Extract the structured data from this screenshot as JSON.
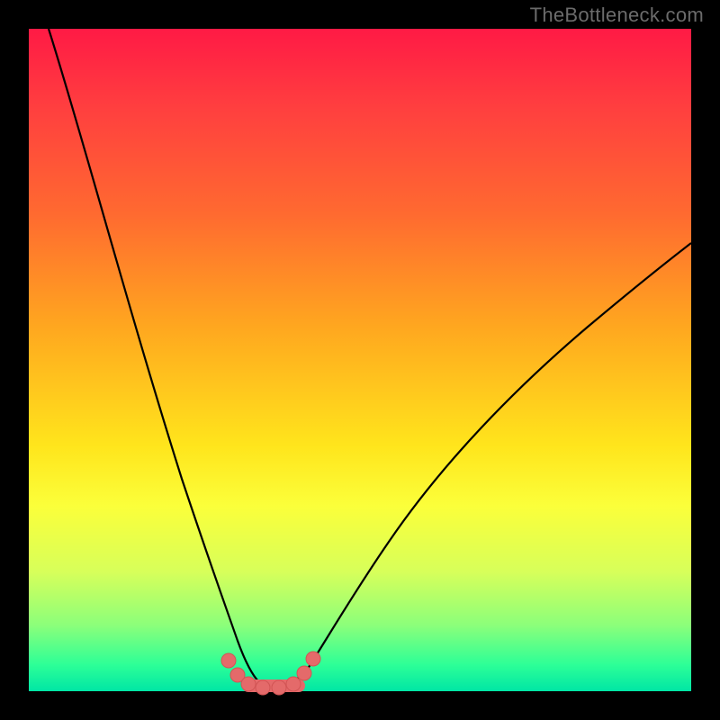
{
  "watermark": "TheBottleneck.com",
  "colors": {
    "background": "#000000",
    "gradient_top": "#ff1a45",
    "gradient_mid": "#ffe51c",
    "gradient_bottom": "#00e6a5",
    "curve": "#000000",
    "marker_fill": "#e46a6a"
  },
  "chart_data": {
    "type": "line",
    "title": "",
    "xlabel": "",
    "ylabel": "",
    "xlim": [
      0,
      100
    ],
    "ylim": [
      0,
      100
    ],
    "x": [
      3,
      6,
      9,
      12,
      15,
      18,
      21,
      24,
      27,
      29,
      31,
      33,
      35,
      37,
      40,
      44,
      48,
      52,
      56,
      62,
      70,
      80,
      90,
      100
    ],
    "y": [
      100,
      88,
      77,
      66,
      55,
      44,
      33,
      23,
      14,
      8,
      3,
      1,
      0.5,
      0.5,
      1,
      3,
      7,
      12,
      17,
      24,
      32,
      40,
      47,
      53
    ],
    "series": [
      {
        "name": "bottleneck-curve",
        "x": [
          3,
          6,
          9,
          12,
          15,
          18,
          21,
          24,
          27,
          29,
          31,
          33,
          35,
          37,
          40,
          44,
          48,
          52,
          56,
          62,
          70,
          80,
          90,
          100
        ],
        "y": [
          100,
          88,
          77,
          66,
          55,
          44,
          33,
          23,
          14,
          8,
          3,
          1,
          0.5,
          0.5,
          1,
          3,
          7,
          12,
          17,
          24,
          32,
          40,
          47,
          53
        ]
      }
    ],
    "markers": {
      "x": [
        29,
        30.5,
        32,
        34,
        36,
        38,
        40,
        41.5
      ],
      "y": [
        8,
        5,
        2.5,
        1,
        0.8,
        1.2,
        2.5,
        5
      ]
    },
    "note": "Values estimated from pixel positions; y=0 is the minimum (green, best), y=100 is maximum (red, worst)."
  }
}
